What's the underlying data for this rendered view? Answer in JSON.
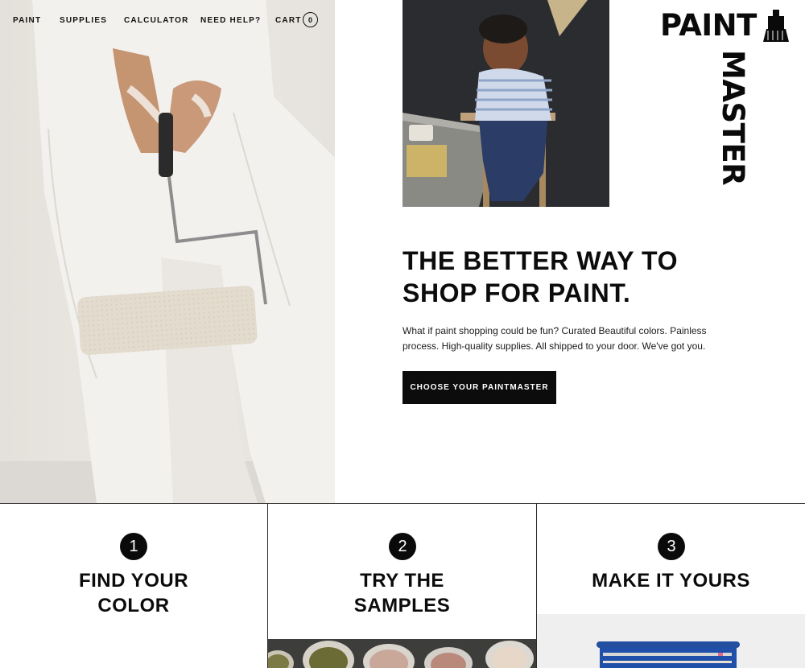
{
  "nav": {
    "items": [
      "PAINT",
      "SUPPLIES",
      "CALCULATOR",
      "NEED HELP?",
      "CART"
    ],
    "cart_count": "0"
  },
  "logo": {
    "line1": "PAINT",
    "line2": "MASTER"
  },
  "hero": {
    "headline": "THE BETTER WAY TO SHOP FOR PAINT.",
    "tagline": "What if paint shopping could be fun? Curated Beautiful colors. Painless process. High-quality supplies. All shipped to your door. We've got you.",
    "cta_label": "CHOOSE YOUR PAINTMASTER"
  },
  "steps": [
    {
      "number": "1",
      "title": "FIND YOUR COLOR"
    },
    {
      "number": "2",
      "title": "TRY THE SAMPLES"
    },
    {
      "number": "3",
      "title": "MAKE IT YOURS"
    }
  ],
  "colors": {
    "ink": "#0c0c0c",
    "bucket_blue": "#1f4fa8"
  }
}
